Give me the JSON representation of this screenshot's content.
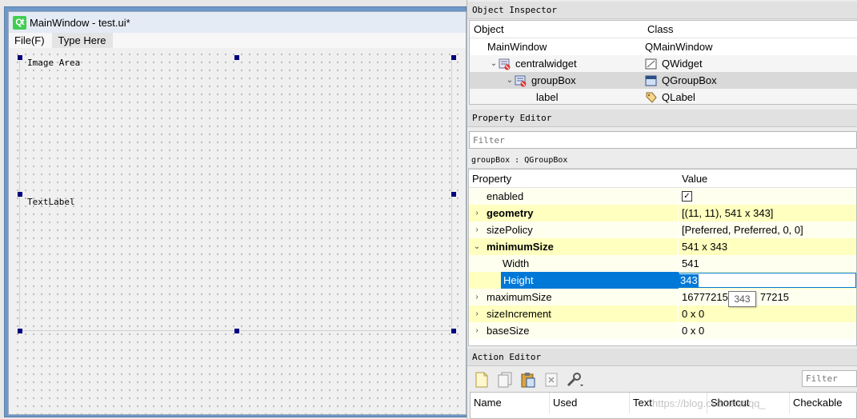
{
  "form": {
    "window_title": "MainWindow - test.ui*",
    "menu": [
      "File(F)",
      "Type Here"
    ],
    "groupbox_title": "Image Area",
    "label_text": "TextLabel"
  },
  "object_inspector": {
    "title": "Object Inspector",
    "columns": [
      "Object",
      "Class"
    ],
    "rows": [
      {
        "object": "MainWindow",
        "class": "QMainWindow"
      },
      {
        "object": "centralwidget",
        "class": "QWidget"
      },
      {
        "object": "groupBox",
        "class": "QGroupBox"
      },
      {
        "object": "label",
        "class": "QLabel"
      }
    ]
  },
  "property_editor": {
    "title": "Property Editor",
    "filter_placeholder": "Filter",
    "context": "groupBox : QGroupBox",
    "columns": [
      "Property",
      "Value"
    ],
    "rows": [
      {
        "name": "enabled",
        "value": "✓"
      },
      {
        "name": "geometry",
        "value": "[(11, 11), 541 x 343]"
      },
      {
        "name": "sizePolicy",
        "value": "[Preferred, Preferred, 0, 0]"
      },
      {
        "name": "minimumSize",
        "value": "541 x 343"
      },
      {
        "name": "Width",
        "value": "541"
      },
      {
        "name": "Height",
        "value": "343"
      },
      {
        "name": "maximumSize",
        "value": "16777215",
        "value_tail": "77215"
      },
      {
        "name": "sizeIncrement",
        "value": "0 x 0"
      },
      {
        "name": "baseSize",
        "value": "0 x 0"
      }
    ],
    "tooltip": "343"
  },
  "action_editor": {
    "title": "Action Editor",
    "filter_placeholder": "Filter",
    "columns": [
      "Name",
      "Used",
      "Text",
      "Shortcut",
      "Checkable"
    ],
    "watermark": "https://blog.csdn.net/qq_"
  }
}
